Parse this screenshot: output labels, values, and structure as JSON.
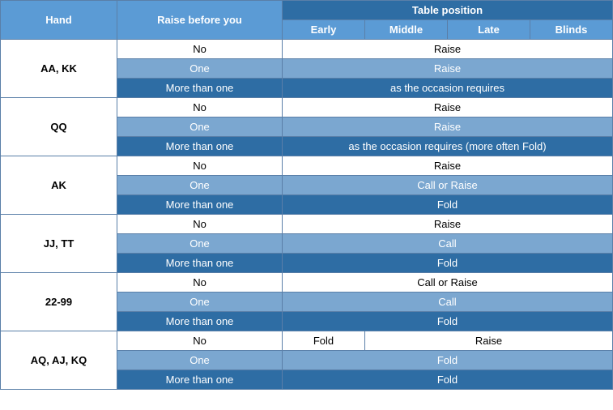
{
  "table": {
    "headers": {
      "hand": "Hand",
      "raise_before": "Raise before you",
      "table_position": "Table position",
      "early": "Early",
      "middle": "Middle",
      "late": "Late",
      "blinds": "Blinds"
    },
    "rows": [
      {
        "hand": "AA, KK",
        "sub_rows": [
          {
            "raise": "No",
            "type": "no",
            "action": "Raise",
            "span": 4
          },
          {
            "raise": "One",
            "type": "one",
            "action": "Raise",
            "span": 4
          },
          {
            "raise": "More than one",
            "type": "more",
            "action": "as the occasion requires",
            "span": 4
          }
        ]
      },
      {
        "hand": "QQ",
        "sub_rows": [
          {
            "raise": "No",
            "type": "no",
            "action": "Raise",
            "span": 4
          },
          {
            "raise": "One",
            "type": "one",
            "action": "Raise",
            "span": 4
          },
          {
            "raise": "More than one",
            "type": "more",
            "action": "as the occasion requires (more often Fold)",
            "span": 4
          }
        ]
      },
      {
        "hand": "AK",
        "sub_rows": [
          {
            "raise": "No",
            "type": "no",
            "action": "Raise",
            "span": 4
          },
          {
            "raise": "One",
            "type": "one",
            "action": "Call or Raise",
            "span": 4
          },
          {
            "raise": "More than one",
            "type": "more",
            "action": "Fold",
            "span": 4
          }
        ]
      },
      {
        "hand": "JJ, TT",
        "sub_rows": [
          {
            "raise": "No",
            "type": "no",
            "action": "Raise",
            "span": 4
          },
          {
            "raise": "One",
            "type": "one",
            "action": "Call",
            "span": 4
          },
          {
            "raise": "More than one",
            "type": "more",
            "action": "Fold",
            "span": 4
          }
        ]
      },
      {
        "hand": "22-99",
        "sub_rows": [
          {
            "raise": "No",
            "type": "no",
            "action": "Call or Raise",
            "span": 4
          },
          {
            "raise": "One",
            "type": "one",
            "action": "Call",
            "span": 4
          },
          {
            "raise": "More than one",
            "type": "more",
            "action": "Fold",
            "span": 4
          }
        ]
      },
      {
        "hand": "AQ, AJ, KQ",
        "sub_rows": [
          {
            "raise": "No",
            "type": "no",
            "action_early": "Fold",
            "action_rest": "Raise",
            "split": true
          },
          {
            "raise": "One",
            "type": "one",
            "action": "Fold",
            "span": 4
          },
          {
            "raise": "More than one",
            "type": "more",
            "action": "Fold",
            "span": 4
          }
        ]
      }
    ]
  }
}
